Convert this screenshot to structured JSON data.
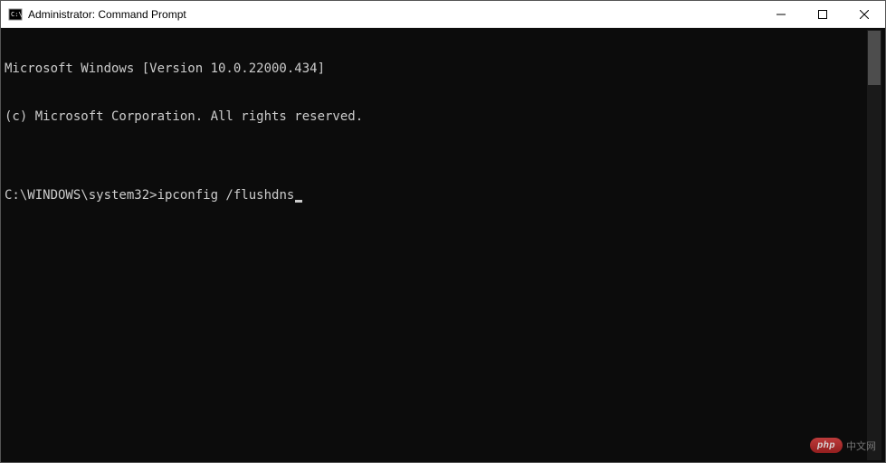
{
  "window": {
    "title": "Administrator: Command Prompt"
  },
  "terminal": {
    "line1": "Microsoft Windows [Version 10.0.22000.434]",
    "line2": "(c) Microsoft Corporation. All rights reserved.",
    "blank": "",
    "prompt": "C:\\WINDOWS\\system32>",
    "command": "ipconfig /flushdns"
  },
  "watermark": {
    "badge": "php",
    "text": "中文网"
  }
}
